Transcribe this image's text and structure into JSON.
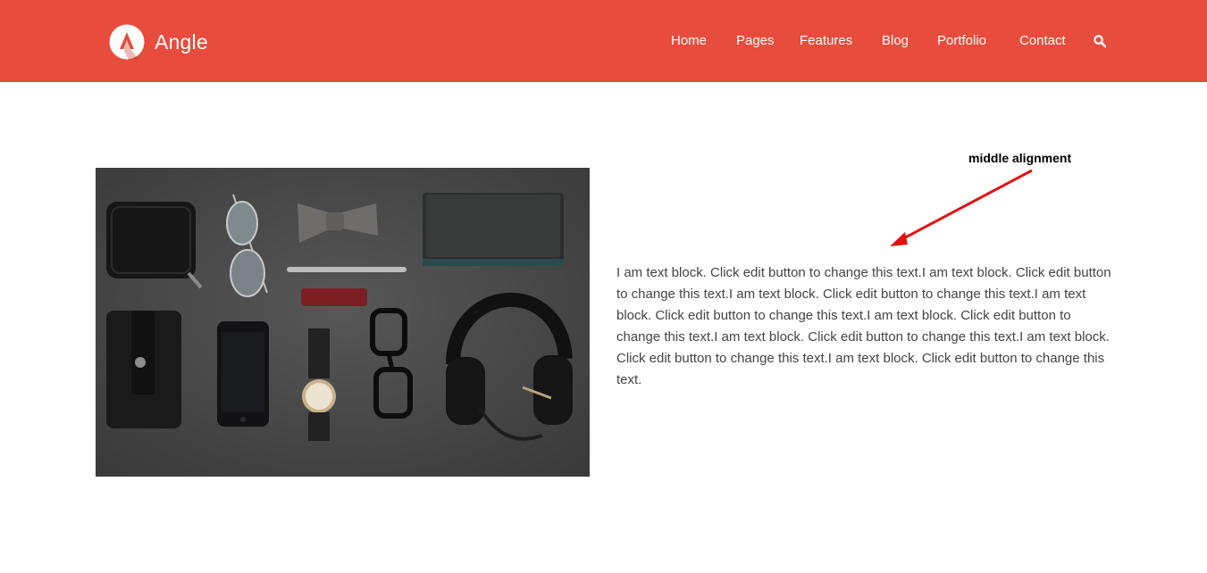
{
  "header": {
    "brand_name": "Angle",
    "bg_color": "#e74c3c",
    "logo_icon": "angle-logo-icon",
    "nav": [
      {
        "label": "Home"
      },
      {
        "label": "Pages"
      },
      {
        "label": "Features"
      },
      {
        "label": "Blog"
      },
      {
        "label": "Portfolio"
      },
      {
        "label": "Contact"
      }
    ],
    "search_icon": "search-icon"
  },
  "main": {
    "image_icon": "flat-lay-accessories-photo",
    "annotation": "middle alignment",
    "arrow_color": "#e41111",
    "text_block": "I am text block. Click edit button to change this text.I am text block. Click edit button to change this text.I am text block. Click edit button to change this text.I am text block. Click edit button to change this text.I am text block. Click edit button to change this text.I am text block. Click edit button to change this text.I am text block. Click edit button to change this text.I am text block. Click edit button to change this text."
  }
}
